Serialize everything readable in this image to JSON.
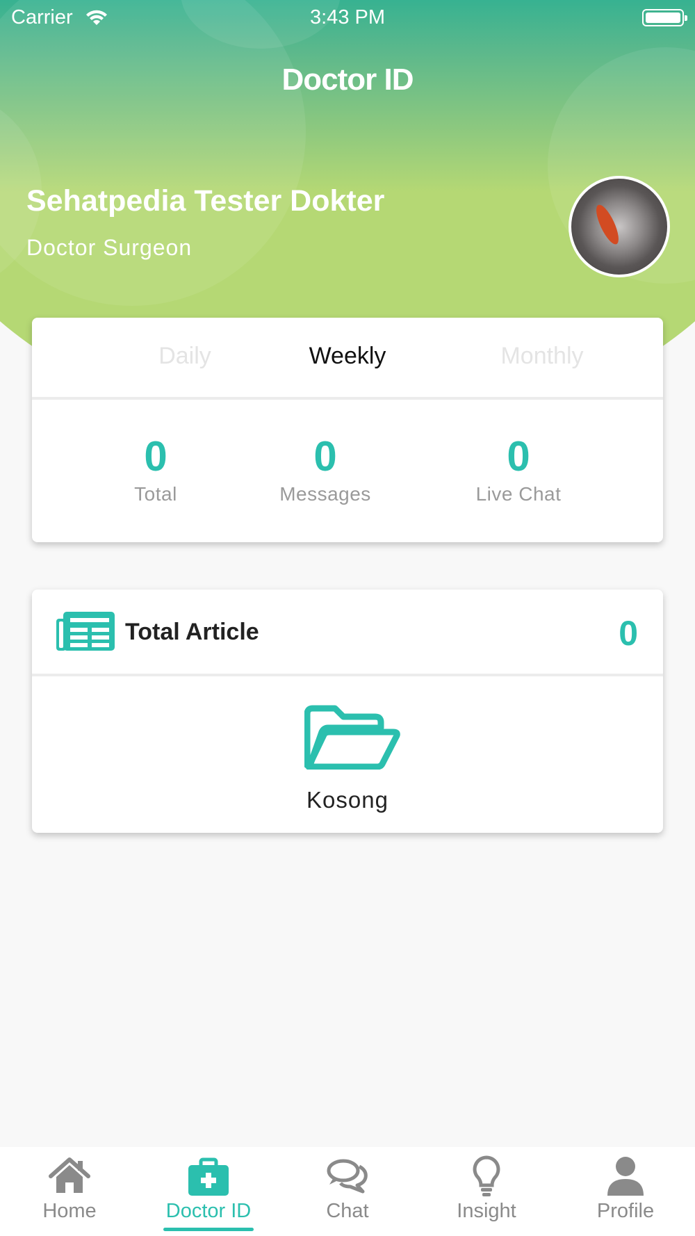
{
  "status_bar": {
    "carrier": "Carrier",
    "time": "3:43 PM"
  },
  "header": {
    "title": "Doctor ID",
    "doctor_name": "Sehatpedia Tester Dokter",
    "doctor_role": "Doctor Surgeon"
  },
  "stats_card": {
    "tabs": [
      {
        "label": "Daily",
        "active": false
      },
      {
        "label": "Weekly",
        "active": true
      },
      {
        "label": "Monthly",
        "active": false
      }
    ],
    "stats": [
      {
        "value": "0",
        "label": "Total"
      },
      {
        "value": "0",
        "label": "Messages"
      },
      {
        "value": "0",
        "label": "Live Chat"
      }
    ]
  },
  "article_card": {
    "title": "Total Article",
    "count": "0",
    "empty_label": "Kosong"
  },
  "tabbar": {
    "items": [
      {
        "label": "Home",
        "icon": "home-icon",
        "active": false
      },
      {
        "label": "Doctor ID",
        "icon": "medical-kit-icon",
        "active": true
      },
      {
        "label": "Chat",
        "icon": "chat-bubbles-icon",
        "active": false
      },
      {
        "label": "Insight",
        "icon": "lightbulb-icon",
        "active": false
      },
      {
        "label": "Profile",
        "icon": "user-icon",
        "active": false
      }
    ]
  },
  "colors": {
    "accent": "#2bbfae",
    "header_top": "#1aae97",
    "header_bottom": "#b5d874",
    "inactive_text": "#8a8a8a"
  }
}
